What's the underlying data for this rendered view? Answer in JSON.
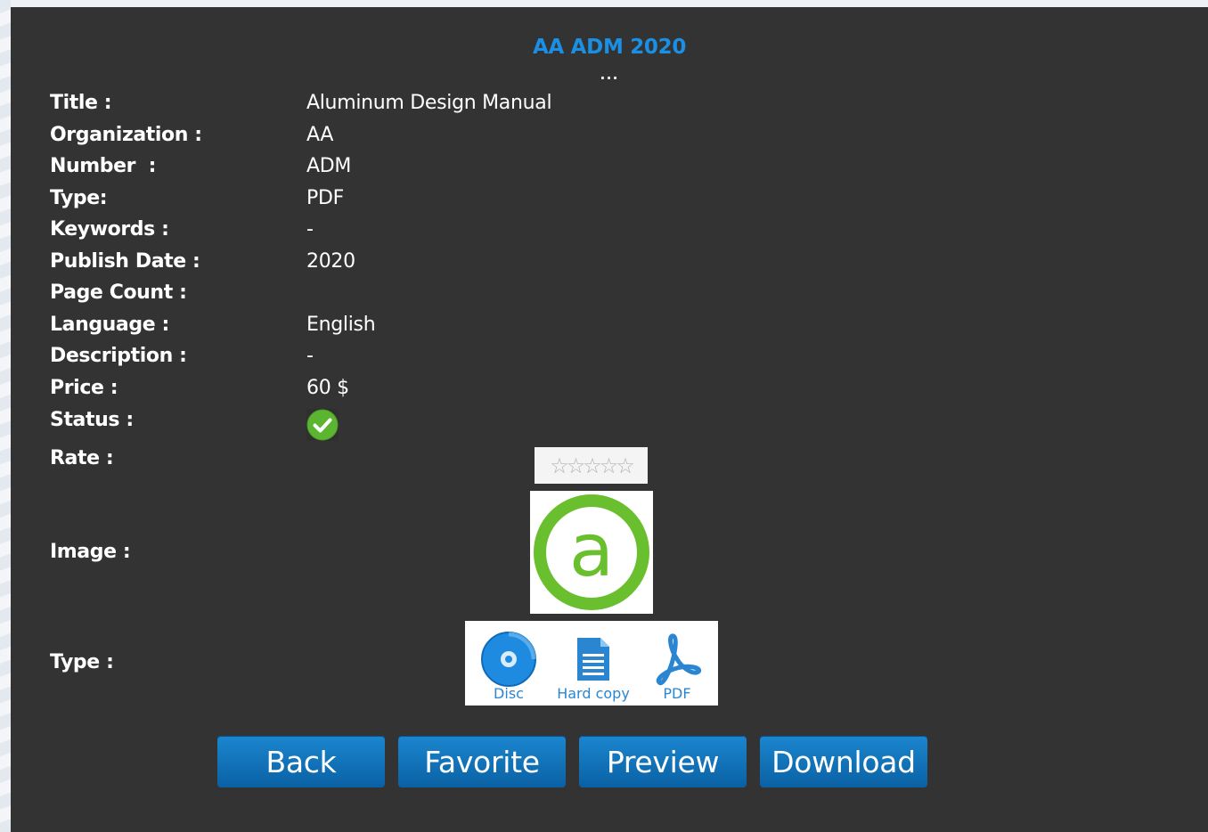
{
  "header": {
    "title": "AA ADM 2020",
    "ellipsis": "..."
  },
  "fields": {
    "title": {
      "label": "Title :",
      "value": "Aluminum Design Manual"
    },
    "organization": {
      "label": "Organization :",
      "value": "AA"
    },
    "number": {
      "label": "Number  :",
      "value": "ADM"
    },
    "type": {
      "label": "Type:",
      "value": "PDF"
    },
    "keywords": {
      "label": "Keywords :",
      "value": "-"
    },
    "publish_date": {
      "label": "Publish Date :",
      "value": "2020"
    },
    "page_count": {
      "label": "Page Count :",
      "value": ""
    },
    "language": {
      "label": "Language :",
      "value": "English"
    },
    "description": {
      "label": "Description :",
      "value": "-"
    },
    "price": {
      "label": "Price :",
      "value": "60 $"
    },
    "status": {
      "label": "Status :",
      "icon": "check-circle-icon",
      "color": "#5cb531"
    },
    "rate": {
      "label": "Rate :",
      "stars_filled": 0,
      "stars_total": 5,
      "stars_text": "☆☆☆☆☆"
    },
    "image": {
      "label": "Image :",
      "logo_icon": "aa-logo-icon",
      "logo_color": "#6abf2e",
      "logo_text": "a"
    },
    "type_formats": {
      "label": "Type :",
      "items": [
        {
          "label": "Disc",
          "icon": "disc-icon"
        },
        {
          "label": "Hard copy",
          "icon": "document-icon"
        },
        {
          "label": "PDF",
          "icon": "pdf-icon"
        }
      ]
    }
  },
  "buttons": {
    "back": "Back",
    "favorite": "Favorite",
    "preview": "Preview",
    "download": "Download"
  },
  "colors": {
    "title_blue": "#1a8fe3",
    "panel": "#333333",
    "button_blue": "#0f72ba"
  }
}
